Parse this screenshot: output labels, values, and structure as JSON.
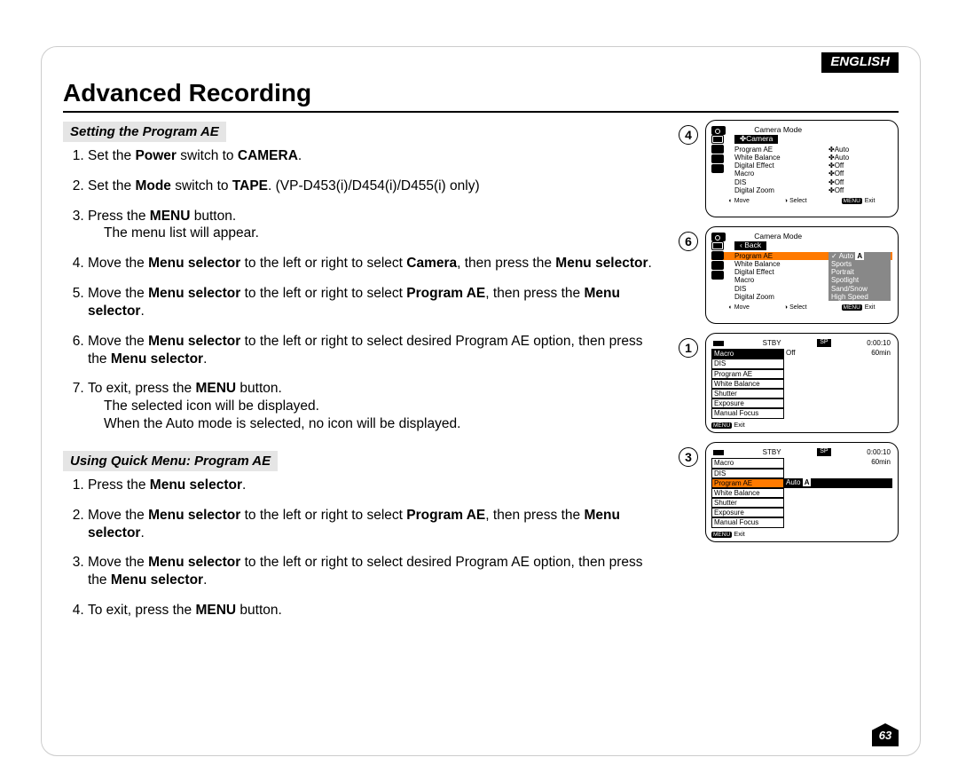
{
  "language_tag": "ENGLISH",
  "page_title": "Advanced Recording",
  "page_number": "63",
  "section1_head": "Setting the Program AE",
  "section2_head": "Using Quick Menu: Program AE",
  "s1": {
    "i1": {
      "pre": "Set the ",
      "b1": "Power",
      "mid": " switch to ",
      "b2": "CAMERA",
      "post": "."
    },
    "i2": {
      "pre": "Set the ",
      "b1": "Mode",
      "mid": " switch to ",
      "b2": "TAPE",
      "post": ". (VP-D453(i)/D454(i)/D455(i) only)"
    },
    "i3": {
      "pre": "Press the ",
      "b1": "MENU",
      "post": " button.",
      "sub": "The menu list will appear."
    },
    "i4": {
      "pre": "Move the ",
      "b1": "Menu selector",
      "mid": " to the left or right to select ",
      "b2": "Camera",
      "mid2": ", then press the ",
      "b3": "Menu selector",
      "post": "."
    },
    "i5": {
      "pre": "Move the ",
      "b1": "Menu selector",
      "mid": " to the left or right to select ",
      "b2": "Program AE",
      "mid2": ", then press the ",
      "b3": "Menu selector",
      "post": "."
    },
    "i6": {
      "pre": "Move the ",
      "b1": "Menu selector",
      "mid": " to the left or right to select desired Program AE option, then press the ",
      "b2": "Menu selector",
      "post": "."
    },
    "i7": {
      "pre": "To exit, press the ",
      "b1": "MENU",
      "post": " button.",
      "sub1": "The selected icon will be displayed.",
      "sub2": "When the Auto mode is selected, no icon will be displayed."
    }
  },
  "s2": {
    "i1": {
      "pre": "Press the ",
      "b1": "Menu selector",
      "post": "."
    },
    "i2": {
      "pre": "Move the ",
      "b1": "Menu selector",
      "mid": " to the left or right to select ",
      "b2": "Program AE",
      "mid2": ", then press the ",
      "b3": "Menu selector",
      "post": "."
    },
    "i3": {
      "pre": "Move the ",
      "b1": "Menu selector",
      "mid": " to the left or right to select desired Program AE option, then press the ",
      "b2": "Menu selector",
      "post": "."
    },
    "i4": {
      "pre": "To exit, press the ",
      "b1": "MENU",
      "post": " button."
    }
  },
  "osd4": {
    "badge": "4",
    "title": "Camera Mode",
    "sub": "✤Camera",
    "rows": [
      {
        "k": "Program AE",
        "v": "✤Auto"
      },
      {
        "k": "White Balance",
        "v": "✤Auto"
      },
      {
        "k": "Digital Effect",
        "v": "✤Off"
      },
      {
        "k": "Macro",
        "v": "✤Off"
      },
      {
        "k": "DIS",
        "v": "✤Off"
      },
      {
        "k": "Digital Zoom",
        "v": "✤Off"
      }
    ],
    "foot": {
      "move": "Move",
      "select": "Select",
      "menu": "MENU",
      "exit": "Exit"
    }
  },
  "osd6": {
    "badge": "6",
    "title": "Camera Mode",
    "sub": "Back",
    "rows_left": [
      "Program AE",
      "White Balance",
      "Digital Effect",
      "Macro",
      "DIS",
      "Digital Zoom"
    ],
    "rows_right": [
      {
        "v": "Auto",
        "chk": true,
        "tag": "A"
      },
      {
        "v": "Sports"
      },
      {
        "v": "Portrait"
      },
      {
        "v": "Spotlight"
      },
      {
        "v": "Sand/Snow"
      },
      {
        "v": "High Speed"
      }
    ],
    "foot": {
      "move": "Move",
      "select": "Select",
      "menu": "MENU",
      "exit": "Exit"
    }
  },
  "qm1": {
    "badge": "1",
    "stby": "STBY",
    "sp": "SP",
    "time": "0:00:10",
    "tape": "60min",
    "rows": [
      {
        "k": "Macro",
        "sel": true,
        "v": "Off"
      },
      {
        "k": "DIS"
      },
      {
        "k": "Program AE"
      },
      {
        "k": "White Balance"
      },
      {
        "k": "Shutter"
      },
      {
        "k": "Exposure"
      },
      {
        "k": "Manual Focus"
      }
    ],
    "foot_menu": "MENU",
    "foot_exit": "Exit"
  },
  "qm3": {
    "badge": "3",
    "stby": "STBY",
    "sp": "SP",
    "time": "0:00:10",
    "tape": "60min",
    "rows": [
      {
        "k": "Macro"
      },
      {
        "k": "DIS"
      },
      {
        "k": "Program AE",
        "hl": true,
        "v": "Auto",
        "tag": "A"
      },
      {
        "k": "White Balance"
      },
      {
        "k": "Shutter"
      },
      {
        "k": "Exposure"
      },
      {
        "k": "Manual Focus"
      }
    ],
    "foot_menu": "MENU",
    "foot_exit": "Exit"
  }
}
